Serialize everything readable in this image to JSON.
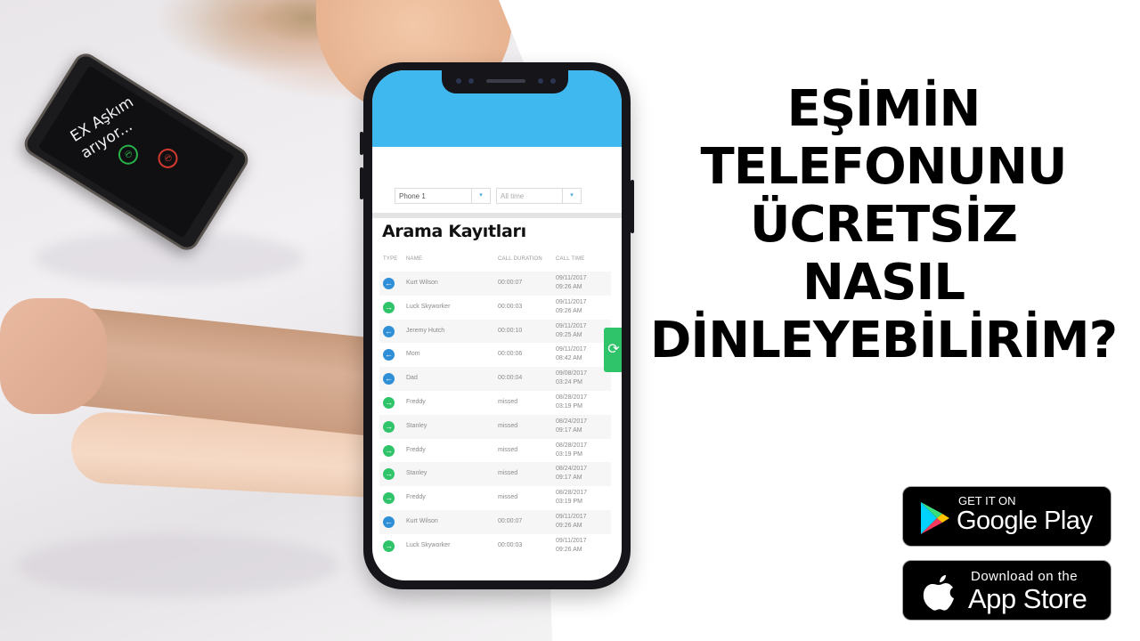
{
  "background_photo": {
    "description": "couple lying in bed holding hands on white sheets",
    "small_phone": {
      "caller_text_line1": "EX Aşkım",
      "caller_text_line2": "arıyor...",
      "accept_icon": "phone-accept-icon",
      "decline_icon": "phone-decline-icon"
    }
  },
  "app": {
    "header_color": "#3fb8f0",
    "filters": {
      "phone_select": "Phone 1",
      "time_select_placeholder": "All time",
      "caret": "▾"
    },
    "title": "Arama Kayıtları",
    "columns": {
      "type": "TYPE",
      "name": "NAME",
      "duration": "CALL DURATION",
      "time": "CALL TIME"
    },
    "refresh_icon": "⟳",
    "refresh_color": "#2fc36a",
    "incoming_color": "#2f8fd6",
    "outgoing_color": "#2fc36a",
    "calls": [
      {
        "type": "incoming",
        "name": "Kurt Wilson",
        "duration": "00:00:07",
        "date": "09/11/2017",
        "time": "09:26 AM"
      },
      {
        "type": "outgoing",
        "name": "Luck Skyworker",
        "duration": "00:00:03",
        "date": "09/11/2017",
        "time": "09:26 AM"
      },
      {
        "type": "incoming",
        "name": "Jeremy Hutch",
        "duration": "00:00:10",
        "date": "09/11/2017",
        "time": "09:25 AM"
      },
      {
        "type": "incoming",
        "name": "Mom",
        "duration": "00:00:06",
        "date": "09/11/2017",
        "time": "08:42 AM"
      },
      {
        "type": "incoming",
        "name": "Dad",
        "duration": "00:00:04",
        "date": "09/08/2017",
        "time": "03:24 PM"
      },
      {
        "type": "outgoing",
        "name": "Freddy",
        "duration": "missed",
        "date": "08/28/2017",
        "time": "03:19 PM"
      },
      {
        "type": "outgoing",
        "name": "Stanley",
        "duration": "missed",
        "date": "08/24/2017",
        "time": "09:17 AM"
      },
      {
        "type": "outgoing",
        "name": "Freddy",
        "duration": "missed",
        "date": "08/28/2017",
        "time": "03:19 PM"
      },
      {
        "type": "outgoing",
        "name": "Stanley",
        "duration": "missed",
        "date": "08/24/2017",
        "time": "09:17 AM"
      },
      {
        "type": "outgoing",
        "name": "Freddy",
        "duration": "missed",
        "date": "08/28/2017",
        "time": "03:19 PM"
      },
      {
        "type": "incoming",
        "name": "Kurt Wilson",
        "duration": "00:00:07",
        "date": "09/11/2017",
        "time": "09:26 AM"
      },
      {
        "type": "outgoing",
        "name": "Luck Skyworker",
        "duration": "00:00:03",
        "date": "09/11/2017",
        "time": "09:26 AM"
      }
    ]
  },
  "headline": {
    "lines": [
      "EŞİMİN",
      "TELEFONUNU",
      "ÜCRETSİZ",
      "NASIL",
      "DİNLEYEBİLİRİM?"
    ]
  },
  "badges": {
    "google_play": {
      "small": "GET IT ON",
      "big": "Google Play",
      "icon": "google-play-icon"
    },
    "app_store": {
      "small": "Download on the",
      "big": "App Store",
      "icon": "apple-icon"
    }
  }
}
